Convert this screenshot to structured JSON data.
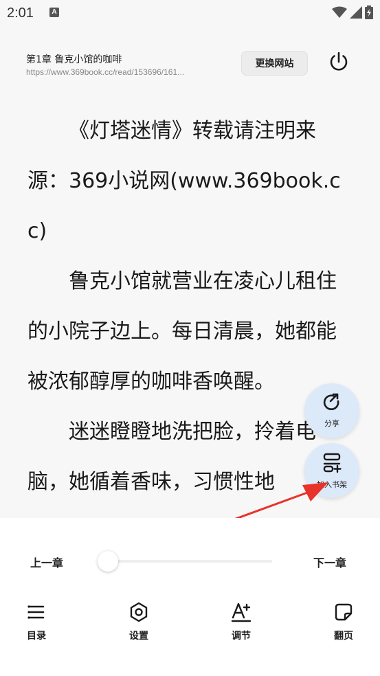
{
  "status_bar": {
    "time": "2:01",
    "notification_letter": "A",
    "icons": [
      "wifi-icon",
      "signal-icon",
      "battery-icon"
    ]
  },
  "header": {
    "chapter_title": "第1章 鲁克小馆的咖啡",
    "url": "https://www.369book.cc/read/153696/161...",
    "switch_site_label": "更换网站",
    "power_icon": "power-icon"
  },
  "content": {
    "paragraphs": [
      "《灯塔迷情》转载请注明来源：369小说网(www.369book.cc)",
      "鲁克小馆就营业在凌心儿租住的小院子边上。每日清晨，她都能被浓郁醇厚的咖啡香唤醒。",
      "迷迷瞪瞪地洗把脸，拎着电脑，她循着香味，习惯性地"
    ]
  },
  "floating": {
    "share_label": "分享",
    "bookshelf_label": "加入书架"
  },
  "panel": {
    "prev_chapter": "上一章",
    "next_chapter": "下一章",
    "progress": 0,
    "nav": [
      {
        "label": "目录",
        "icon": "list-icon"
      },
      {
        "label": "设置",
        "icon": "settings-icon"
      },
      {
        "label": "调节",
        "icon": "font-adjust-icon"
      },
      {
        "label": "翻页",
        "icon": "page-turn-icon"
      }
    ]
  },
  "colors": {
    "background": "#f7f7f7",
    "panel": "#ffffff",
    "fab": "#dce9f8",
    "arrow": "#e8332a",
    "text": "#1a1a1a"
  }
}
